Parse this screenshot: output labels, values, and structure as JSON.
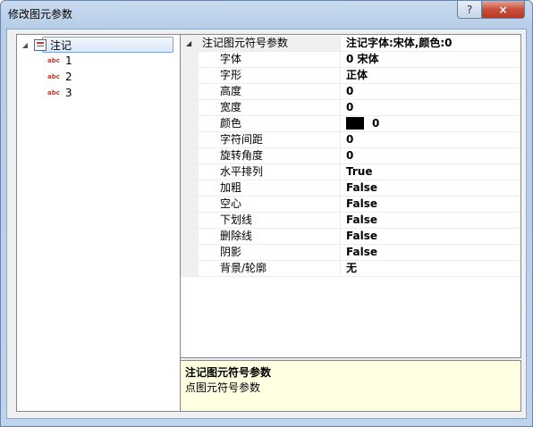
{
  "window": {
    "title": "修改图元参数",
    "help_label": "?",
    "close_label": "×"
  },
  "tree": {
    "root_label": "注记",
    "children": [
      {
        "icon": "abc",
        "label": "1"
      },
      {
        "icon": "abc",
        "label": "2"
      },
      {
        "icon": "abc",
        "label": "3"
      }
    ]
  },
  "property_grid": {
    "category": {
      "name": "注记图元符号参数",
      "value": "注记字体:宋体,颜色:0"
    },
    "properties": [
      {
        "name": "字体",
        "value": "0 宋体"
      },
      {
        "name": "字形",
        "value": "正体"
      },
      {
        "name": "高度",
        "value": "0"
      },
      {
        "name": "宽度",
        "value": "0"
      },
      {
        "name": "颜色",
        "value": "0",
        "swatch": "#000000"
      },
      {
        "name": "字符间距",
        "value": "0"
      },
      {
        "name": "旋转角度",
        "value": "0"
      },
      {
        "name": "水平排列",
        "value": "True"
      },
      {
        "name": "加粗",
        "value": "False"
      },
      {
        "name": "空心",
        "value": "False"
      },
      {
        "name": "下划线",
        "value": "False"
      },
      {
        "name": "删除线",
        "value": "False"
      },
      {
        "name": "阴影",
        "value": "False"
      },
      {
        "name": "背景/轮廓",
        "value": "无"
      }
    ]
  },
  "description": {
    "title": "注记图元符号参数",
    "text": "点图元符号参数"
  }
}
